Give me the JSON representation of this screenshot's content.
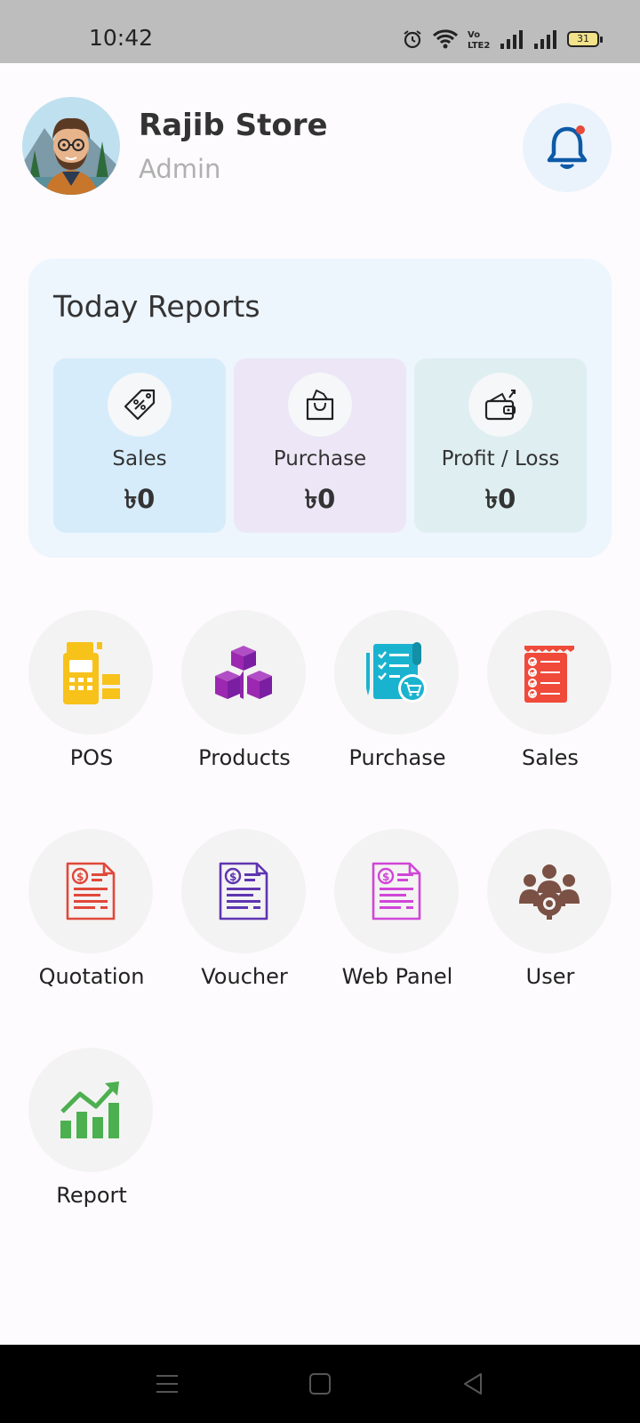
{
  "status_bar": {
    "time": "10:42",
    "battery": "31",
    "icons": [
      "alarm-icon",
      "wifi-icon",
      "volte-icon",
      "signal-icon",
      "signal-icon-2",
      "battery-icon"
    ]
  },
  "header": {
    "store_name": "Rajib Store",
    "role": "Admin",
    "notification_icon": "bell-icon",
    "notification_dot_color": "#e84a3c"
  },
  "today_reports": {
    "title": "Today Reports",
    "tiles": [
      {
        "label": "Sales",
        "value": "৳0",
        "icon": "price-tag-icon",
        "bg": "#d6ecfb"
      },
      {
        "label": "Purchase",
        "value": "৳0",
        "icon": "shopping-bag-icon",
        "bg": "#ece6f6"
      },
      {
        "label": "Profit / Loss",
        "value": "৳0",
        "icon": "wallet-icon",
        "bg": "#deeef1"
      }
    ]
  },
  "menu": {
    "items": [
      {
        "label": "POS",
        "icon": "pos-terminal-icon",
        "color": "#f7c21a"
      },
      {
        "label": "Products",
        "icon": "boxes-icon",
        "color": "#9c27b0"
      },
      {
        "label": "Purchase",
        "icon": "purchase-invoice-icon",
        "color": "#1ab3cf"
      },
      {
        "label": "Sales",
        "icon": "receipt-checklist-icon",
        "color": "#ef4a3a"
      },
      {
        "label": "Quotation",
        "icon": "quotation-document-icon",
        "color": "#e0483a"
      },
      {
        "label": "Voucher",
        "icon": "voucher-document-icon",
        "color": "#5e35b1"
      },
      {
        "label": "Web Panel",
        "icon": "web-panel-document-icon",
        "color": "#d046d8"
      },
      {
        "label": "User",
        "icon": "users-gear-icon",
        "color": "#7a5144"
      },
      {
        "label": "Report",
        "icon": "growth-chart-icon",
        "color": "#4caf50"
      }
    ]
  },
  "colors": {
    "accent_blue": "#0d5aa7",
    "background": "#fdfbfd",
    "card": "#edf5fd"
  }
}
